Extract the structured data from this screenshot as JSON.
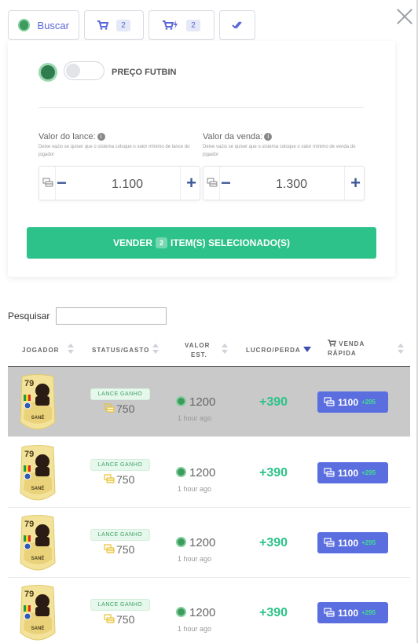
{
  "toolbar": {
    "search_label": "Buscar",
    "cart_count": "2",
    "quick_count": "2"
  },
  "close_icon": "close-icon",
  "panel": {
    "futbin_label": "PREÇO FUTBIN",
    "futbin_enabled": false,
    "bid": {
      "label": "Valor do lance:",
      "hint": "Deixe vazio se quiser que o sistema coloque o valor mínimo de lance do jogador",
      "value": "1.100"
    },
    "sale": {
      "label": "Valor da venda:",
      "hint": "Deixe vazio se quiser que o sistema coloque o valor mínimo de venda do jogador",
      "value": "1.300"
    },
    "sell_button": {
      "prefix": "VENDER",
      "count": "2",
      "suffix": "ITEM(S) SELECIONADO(S)"
    }
  },
  "search": {
    "label": "Pesquisar",
    "value": ""
  },
  "table": {
    "headers": {
      "player": "JOGADOR",
      "status": "STATUS/GASTO",
      "value_line1": "VALOR",
      "value_line2": "EST.",
      "profit": "LUCRO/PERDA",
      "quick_line1": "VENDA",
      "quick_line2": "RÁPIDA"
    },
    "rows": [
      {
        "rating": "79",
        "name": "SANÉ",
        "status": "LANCE GANHO",
        "spent": "750",
        "value": "1200",
        "time": "1 hour ago",
        "profit": "+390",
        "quick_price": "1100",
        "quick_gain": "+295"
      },
      {
        "rating": "79",
        "name": "SANÉ",
        "status": "LANCE GANHO",
        "spent": "750",
        "value": "1200",
        "time": "1 hour ago",
        "profit": "+390",
        "quick_price": "1100",
        "quick_gain": "+295"
      },
      {
        "rating": "79",
        "name": "SANÉ",
        "status": "LANCE GANHO",
        "spent": "750",
        "value": "1200",
        "time": "1 hour ago",
        "profit": "+390",
        "quick_price": "1100",
        "quick_gain": "+295"
      },
      {
        "rating": "79",
        "name": "SANÉ",
        "status": "LANCE GANHO",
        "spent": "750",
        "value": "1200",
        "time": "1 hour ago",
        "profit": "+390",
        "quick_price": "1100",
        "quick_gain": "+295"
      }
    ]
  },
  "colors": {
    "accent": "#5b6ee0",
    "success": "#2dc28a",
    "selected_row": "#c9c9c9"
  }
}
